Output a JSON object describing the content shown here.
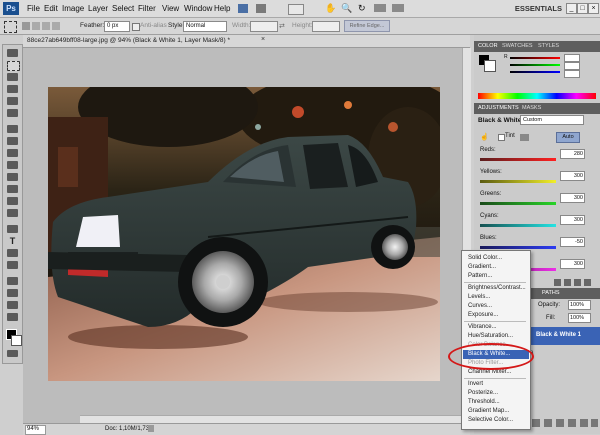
{
  "menubar": {
    "logo": "Ps",
    "items": [
      "File",
      "Edit",
      "Image",
      "Layer",
      "Select",
      "Filter",
      "View",
      "Window",
      "Help"
    ],
    "workspace": "ESSENTIALS"
  },
  "options": {
    "feather_label": "Feather:",
    "feather_value": "0 px",
    "antialias_label": "Anti-alias",
    "style_label": "Style:",
    "style_value": "Normal",
    "width_label": "Width:",
    "height_label": "Height:",
    "refine_label": "Refine Edge..."
  },
  "document": {
    "title": "88ce27ab649bff08-large.jpg @ 94% (Black & White 1, Layer Mask/8) *",
    "zoom": "94%",
    "doc_size": "Doc: 1,10M/1,73M"
  },
  "color_panel": {
    "tabs": [
      "COLOR",
      "SWATCHES",
      "STYLES"
    ]
  },
  "adjustments_panel": {
    "tabs": [
      "ADJUSTMENTS",
      "MASKS"
    ],
    "title": "Black & White",
    "preset": "Custom",
    "tint_label": "Tint",
    "auto_label": "Auto",
    "sliders": [
      {
        "label": "Reds:",
        "value": "280",
        "color_from": "#5a1e1e",
        "color_to": "#ff2020"
      },
      {
        "label": "Yellows:",
        "value": "300",
        "color_from": "#5a5a10",
        "color_to": "#f2ef2a"
      },
      {
        "label": "Greens:",
        "value": "300",
        "color_from": "#1a4a1a",
        "color_to": "#28d428"
      },
      {
        "label": "Cyans:",
        "value": "300",
        "color_from": "#155050",
        "color_to": "#25e3e3"
      },
      {
        "label": "Blues:",
        "value": "-50",
        "color_from": "#1a1a5a",
        "color_to": "#2d3cf2"
      },
      {
        "label": "Magentas:",
        "value": "300",
        "color_from": "#5a1a5a",
        "color_to": "#ee2ee8"
      }
    ]
  },
  "layers_panel": {
    "tab": "PATHS",
    "opacity_label": "Opacity:",
    "opacity_value": "100%",
    "fill_label": "Fill:",
    "fill_value": "100%",
    "layer_name": "Black & White 1"
  },
  "dropdown": {
    "items": [
      {
        "label": "Solid Color...",
        "disabled": false
      },
      {
        "label": "Gradient...",
        "disabled": false
      },
      {
        "label": "Pattern...",
        "disabled": false
      },
      {
        "label": "Brightness/Contrast...",
        "disabled": false
      },
      {
        "label": "Levels...",
        "disabled": false
      },
      {
        "label": "Curves...",
        "disabled": false
      },
      {
        "label": "Exposure...",
        "disabled": false
      },
      {
        "label": "Vibrance...",
        "disabled": false
      },
      {
        "label": "Hue/Saturation...",
        "disabled": false
      },
      {
        "label": "Color Balance...",
        "disabled": true
      },
      {
        "label": "Black & White...",
        "disabled": false
      },
      {
        "label": "Photo Filter...",
        "disabled": true
      },
      {
        "label": "Channel Mixer...",
        "disabled": false
      },
      {
        "label": "Invert",
        "disabled": false
      },
      {
        "label": "Posterize...",
        "disabled": false
      },
      {
        "label": "Threshold...",
        "disabled": false
      },
      {
        "label": "Gradient Map...",
        "disabled": false
      },
      {
        "label": "Selective Color...",
        "disabled": false
      }
    ],
    "highlighted": "Black & White..."
  },
  "colors": {
    "highlight": "#3a63b5",
    "annotation_circle": "#d41818",
    "car_body": "#2f3a38"
  }
}
